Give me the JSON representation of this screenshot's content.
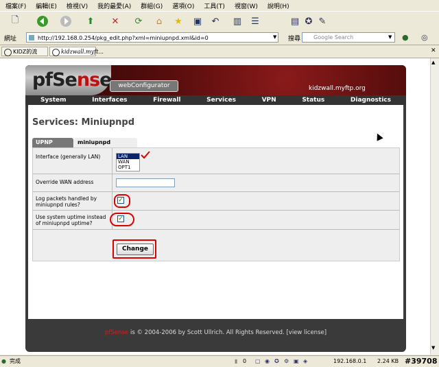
{
  "browser": {
    "menu": [
      "檔案(F)",
      "編輯(E)",
      "檢視(V)",
      "我的最愛(A)",
      "群組(G)",
      "選項(O)",
      "工具(T)",
      "視窗(W)",
      "說明(H)"
    ],
    "address_label": "網址",
    "address_url": "http://192.168.0.254/pkg_edit.php?xml=miniupnpd.xml&id=0",
    "search_label": "搜尋",
    "search_placeholder": "Google Search",
    "tabs": [
      {
        "label": "KIDZ的流量..."
      },
      {
        "label": "kidzwall.myft..."
      }
    ],
    "status_text": "完成",
    "status_count": "0",
    "status_ip": "192.168.0.1",
    "status_size": "2.24 KB",
    "watermark": "#39708"
  },
  "page": {
    "logo_text": "pfSense",
    "webconfigurator": "webConfigurator",
    "hostname": "kidzwall.myftp.org",
    "nav": [
      "System",
      "Interfaces",
      "Firewall",
      "Services",
      "VPN",
      "Status",
      "Diagnostics"
    ],
    "title": "Services: Miniupnpd",
    "tabs": [
      "UPNP Status",
      "miniupnpd Settings"
    ],
    "form": {
      "interface_label": "Interface (generally LAN)",
      "interface_options": [
        "LAN",
        "WAN",
        "OPT1"
      ],
      "interface_selected": "LAN",
      "wan_label": "Override WAN address",
      "wan_value": "",
      "log_label": "Log packets handled by miniupnpd rules?",
      "log_checked": true,
      "uptime_label": "Use system uptime instead of miniupnpd uptime?",
      "uptime_checked": true,
      "change_button": "Change"
    },
    "footer": {
      "brand": "pfSense",
      "copyright": "is © 2004-2006 by Scott Ullrich. All Rights Reserved.",
      "license_link": "[view license]"
    }
  }
}
